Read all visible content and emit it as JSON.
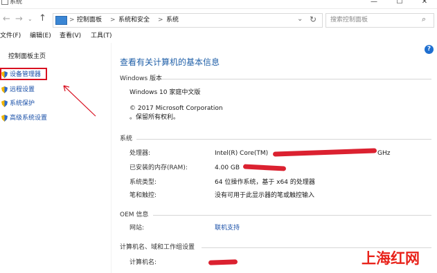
{
  "window": {
    "title": "系统",
    "min_glyph": "—",
    "max_glyph": "☐",
    "close_glyph": "✕"
  },
  "address": {
    "path": [
      "控制面板",
      "系统和安全",
      "系统"
    ],
    "separator": ">",
    "search_placeholder": "搜索控制面板"
  },
  "menu": [
    "文件(F)",
    "编辑(E)",
    "查看(V)",
    "工具(T)"
  ],
  "sidebar": {
    "home": "控制面板主页",
    "items": [
      "设备管理器",
      "远程设置",
      "系统保护",
      "高级系统设置"
    ]
  },
  "main": {
    "heading": "查看有关计算机的基本信息",
    "windows_section": {
      "title": "Windows 版本",
      "edition": "Windows 10 家庭中文版",
      "copyright": "© 2017 Microsoft Corporation",
      "rights": "。保留所有权利。"
    },
    "system_section": {
      "title": "系统",
      "rows": [
        {
          "label": "处理器:",
          "value": "Intel(R) Core(TM)"
        },
        {
          "label": "已安装的内存(RAM):",
          "value": "4.00 GB"
        },
        {
          "label": "系统类型:",
          "value": "64 位操作系统，基于 x64 的处理器"
        },
        {
          "label": "笔和触控:",
          "value": "没有可用于此显示器的笔或触控输入"
        }
      ],
      "cpu_suffix": "GHz"
    },
    "oem_section": {
      "title": "OEM 信息",
      "website_label": "网站:",
      "website_value": "联机支持"
    },
    "computer_section": {
      "title": "计算机名、域和工作组设置",
      "name_label": "计算机名:"
    }
  },
  "help_glyph": "?",
  "watermark": "上海红网",
  "colors": {
    "link": "#1a50a8",
    "heading": "#1f5fa8",
    "highlight_box": "#d81020",
    "redaction": "#d81020",
    "watermark": "#e8231b"
  }
}
